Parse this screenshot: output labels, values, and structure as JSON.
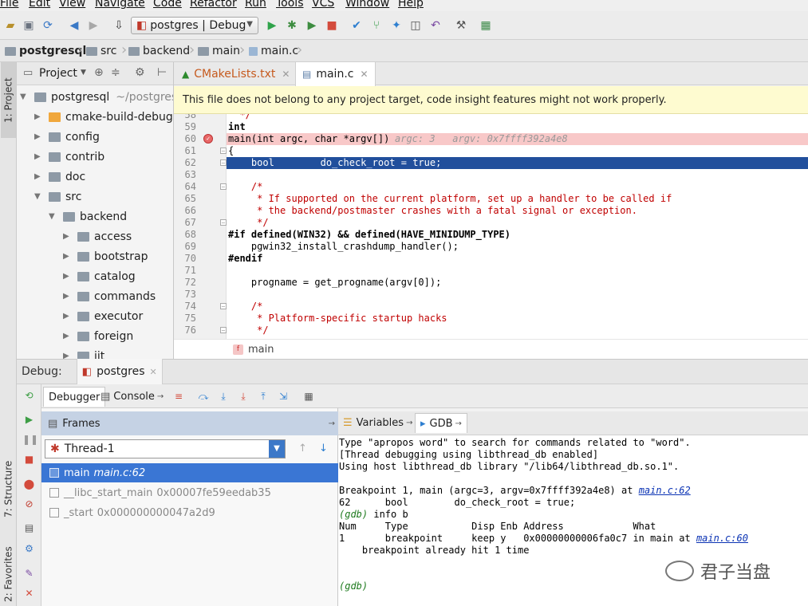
{
  "menu": [
    "File",
    "Edit",
    "View",
    "Navigate",
    "Code",
    "Refactor",
    "Run",
    "Tools",
    "VCS",
    "Window",
    "Help"
  ],
  "toolbar": {
    "run_config": "postgres | Debug"
  },
  "breadcrumb": [
    "postgresql",
    "src",
    "backend",
    "main",
    "main.c"
  ],
  "left_strip": {
    "project_tab": "1: Project",
    "structure_tab": "7: Structure",
    "favorites_tab": "2: Favorites"
  },
  "project": {
    "title": "Project",
    "tree": [
      {
        "label": "postgresql",
        "hint": "~/postgresq",
        "expanded": true,
        "depth": 0
      },
      {
        "label": "cmake-build-debug",
        "hint": "",
        "expanded": false,
        "depth": 1,
        "orange": true
      },
      {
        "label": "config",
        "hint": "",
        "expanded": false,
        "depth": 1
      },
      {
        "label": "contrib",
        "hint": "",
        "expanded": false,
        "depth": 1
      },
      {
        "label": "doc",
        "hint": "",
        "expanded": false,
        "depth": 1
      },
      {
        "label": "src",
        "hint": "",
        "expanded": true,
        "depth": 1
      },
      {
        "label": "backend",
        "hint": "",
        "expanded": true,
        "depth": 2
      },
      {
        "label": "access",
        "hint": "",
        "expanded": false,
        "depth": 3
      },
      {
        "label": "bootstrap",
        "hint": "",
        "expanded": false,
        "depth": 3
      },
      {
        "label": "catalog",
        "hint": "",
        "expanded": false,
        "depth": 3
      },
      {
        "label": "commands",
        "hint": "",
        "expanded": false,
        "depth": 3
      },
      {
        "label": "executor",
        "hint": "",
        "expanded": false,
        "depth": 3
      },
      {
        "label": "foreign",
        "hint": "",
        "expanded": false,
        "depth": 3
      },
      {
        "label": "jit",
        "hint": "",
        "expanded": false,
        "depth": 3
      }
    ]
  },
  "editor": {
    "tabs": [
      {
        "label": "CMakeLists.txt",
        "active": false
      },
      {
        "label": "main.c",
        "active": true
      }
    ],
    "banner": "This file does not belong to any project target, code insight features might not work properly.",
    "lines": [
      {
        "n": "58",
        "text": "  */"
      },
      {
        "n": "59",
        "text": "int"
      },
      {
        "n": "60",
        "text": "main(int argc, char *argv[])"
      },
      {
        "n": "61",
        "text": "{"
      },
      {
        "n": "62",
        "text": "    bool        do_check_root = true;"
      },
      {
        "n": "63",
        "text": ""
      },
      {
        "n": "64",
        "text": "    /*"
      },
      {
        "n": "65",
        "text": "     * If supported on the current platform, set up a handler to be called if"
      },
      {
        "n": "66",
        "text": "     * the backend/postmaster crashes with a fatal signal or exception."
      },
      {
        "n": "67",
        "text": "     */"
      },
      {
        "n": "68",
        "text": "#if defined(WIN32) && defined(HAVE_MINIDUMP_TYPE)"
      },
      {
        "n": "69",
        "text": "    pgwin32_install_crashdump_handler();"
      },
      {
        "n": "70",
        "text": "#endif"
      },
      {
        "n": "71",
        "text": ""
      },
      {
        "n": "72",
        "text": "    progname = get_progname(argv[0]);"
      },
      {
        "n": "73",
        "text": ""
      },
      {
        "n": "74",
        "text": "    /*"
      },
      {
        "n": "75",
        "text": "     * Platform-specific startup hacks"
      },
      {
        "n": "76",
        "text": "     */"
      }
    ],
    "inline_values": "argc: 3   argv: 0x7ffff392a4e8",
    "footer_function": "main"
  },
  "debug": {
    "label": "Debug:",
    "session": "postgres",
    "tabs": [
      "Debugger",
      "Console"
    ],
    "frames_title": "Frames",
    "thread": "Thread-1",
    "frames": [
      {
        "fn": "main",
        "loc": "main.c:62",
        "selected": true
      },
      {
        "fn": "__libc_start_main",
        "loc": "0x00007fe59eedab35",
        "selected": false
      },
      {
        "fn": "_start",
        "loc": "0x000000000047a2d9",
        "selected": false
      }
    ],
    "right_tabs": [
      "Variables",
      "GDB"
    ],
    "gdb_lines": [
      "Type \"apropos word\" to search for commands related to \"word\".",
      "[Thread debugging using libthread_db enabled]",
      "Using host libthread_db library \"/lib64/libthread_db.so.1\".",
      "",
      "Breakpoint 1, main (argc=3, argv=0x7ffff392a4e8) at ",
      "62      bool        do_check_root = true;",
      "info b",
      "Num     Type           Disp Enb Address            What",
      "1       breakpoint     keep y   0x00000000006fa0c7 in main at ",
      "    breakpoint already hit 1 time",
      "",
      "",
      ""
    ],
    "gdb_link_1": "main.c:62",
    "gdb_link_2": "main.c:60",
    "gdb_prompt": "(gdb)"
  },
  "watermark": "君子当盘"
}
